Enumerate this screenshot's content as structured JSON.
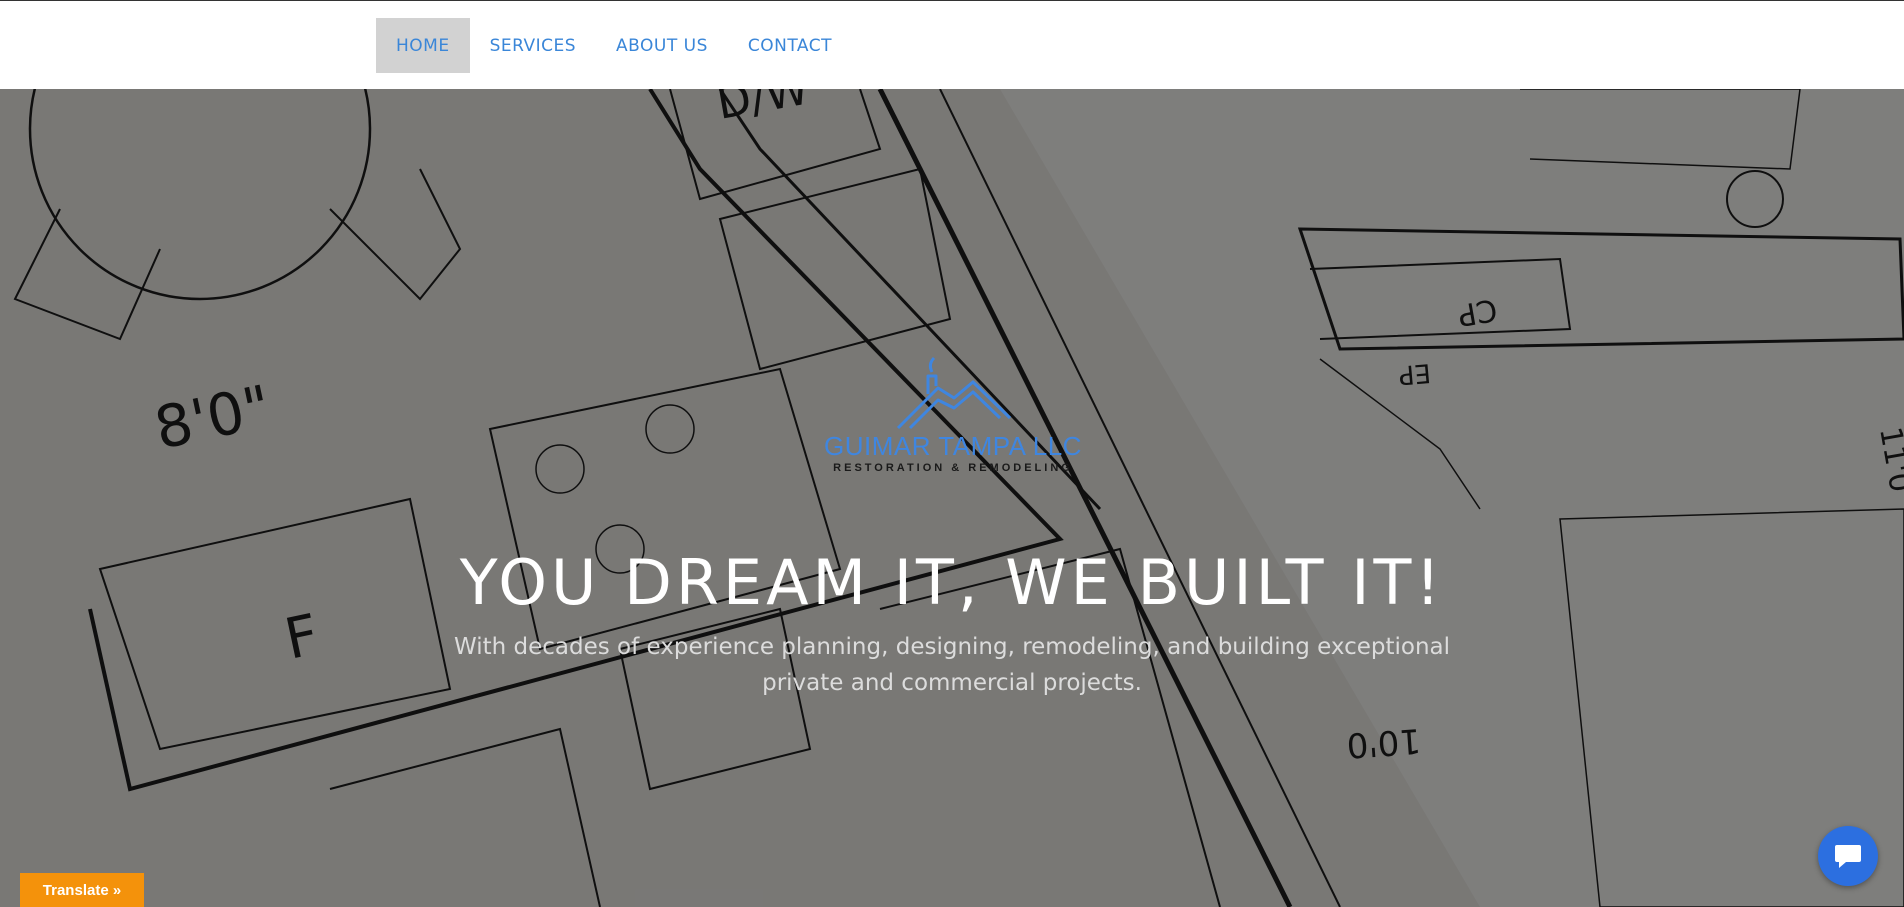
{
  "nav": {
    "items": [
      {
        "label": "HOME",
        "active": true
      },
      {
        "label": "SERVICES",
        "active": false
      },
      {
        "label": "ABOUT US",
        "active": false
      },
      {
        "label": "CONTACT",
        "active": false
      }
    ]
  },
  "hero": {
    "logo": {
      "name": "GUIMAR TAMPA LLC",
      "tagline": "RESTORATION & REMODELING",
      "icon": "house-roof-logo-icon"
    },
    "headline": "YOU DREAM IT, WE BUILT IT!",
    "subtext": "With decades of experience planning, designing, remodeling, and building exceptional private and commercial projects."
  },
  "widgets": {
    "translate_label": "Translate »",
    "chat_icon": "chat-bubble-icon"
  },
  "colors": {
    "nav_link": "#3a86d8",
    "nav_active_bg": "#d2d2d2",
    "logo_blue": "#3f86e0",
    "translate_bg": "#f4920b",
    "chat_bg": "#2c6fe0"
  }
}
